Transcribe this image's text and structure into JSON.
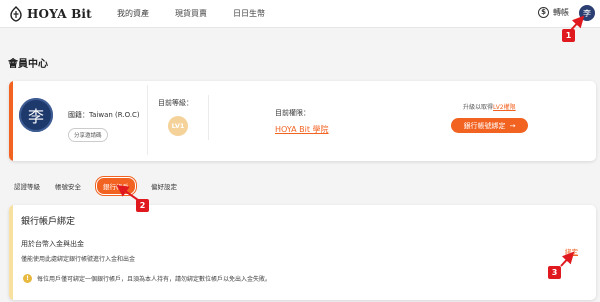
{
  "header": {
    "brand": "HOYA Bit",
    "nav": [
      "我的資產",
      "現貨買賣",
      "日日生幣"
    ],
    "lang_label": "轉帳",
    "lang_icon_glyph": "$",
    "avatar_char": "李"
  },
  "page": {
    "title": "會員中心"
  },
  "member": {
    "avatar_char": "李",
    "nationality": "國籍：Taiwan (R.O.C)",
    "share_code_label": "分享邀請碼",
    "level_label": "目前等級：",
    "level_value": "LV1",
    "permission_label": "目前權限：",
    "permission_link": "HOYA Bit 學院",
    "upgrade_prefix": "升級以取得",
    "upgrade_level": "LV2權限",
    "bind_bank_button": "銀行帳號綁定",
    "bind_bank_arrow": "→"
  },
  "tabs": [
    "認證等級",
    "帳號安全",
    "銀行帳戶",
    "偏好設定"
  ],
  "active_tab": 2,
  "bank": {
    "title": "銀行帳戶綁定",
    "subtitle": "用於台幣入金與出金",
    "description": "僅能使用此處綁定銀行帳號進行入金和出金",
    "notice": "每位用戶僅可綁定一個銀行帳戶，且須為本人持有，請勿綁定數位帳戶以免出入金失敗。",
    "notice_icon_glyph": "!",
    "bind_link": "綁定"
  },
  "annotations": [
    "1",
    "2",
    "3"
  ],
  "colors": {
    "accent": "#f26322",
    "annotation": "#e0191f",
    "level_badge": "#f5d29a"
  }
}
